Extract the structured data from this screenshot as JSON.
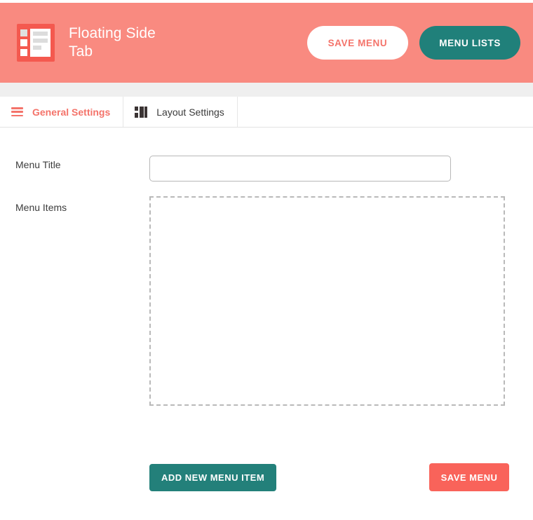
{
  "header": {
    "brand_title": "Floating Side Tab",
    "logo_icon": "side-tab-logo-icon",
    "save_button_label": "SAVE MENU",
    "menu_lists_button_label": "MENU LISTS",
    "background_color": "#f98a80",
    "logo_color": "#f4594f",
    "teal_color": "#20807a",
    "save_text_color": "#f4736a"
  },
  "tabs": [
    {
      "label": "General Settings",
      "icon": "hamburger-icon",
      "active": true,
      "color": "#f4736a"
    },
    {
      "label": "Layout Settings",
      "icon": "layout-grid-icon",
      "active": false,
      "color": "#3a3a3a"
    }
  ],
  "form": {
    "menu_title": {
      "label": "Menu Title",
      "value": "",
      "placeholder": ""
    },
    "menu_items": {
      "label": "Menu Items",
      "dropzone_empty": true
    },
    "add_new_menu_item_label": "ADD NEW MENU ITEM",
    "save_menu_label": "SAVE MENU",
    "add_button_color": "#23807a",
    "save_button_color": "#f9635a"
  }
}
